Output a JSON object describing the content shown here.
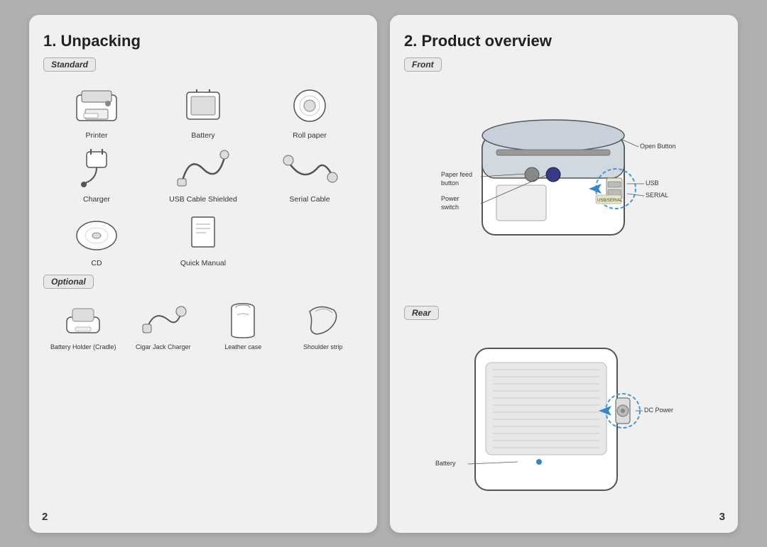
{
  "leftPage": {
    "title": "1. Unpacking",
    "pageNum": "2",
    "standard": {
      "badge": "Standard",
      "items": [
        {
          "label": "Printer",
          "icon": "printer"
        },
        {
          "label": "Battery",
          "icon": "battery"
        },
        {
          "label": "Roll paper",
          "icon": "rollpaper"
        },
        {
          "label": "Charger",
          "icon": "charger"
        },
        {
          "label": "USB Cable Shielded",
          "icon": "usbcable"
        },
        {
          "label": "Serial Cable",
          "icon": "serialcable"
        },
        {
          "label": "CD",
          "icon": "cd"
        },
        {
          "label": "Quick Manual",
          "icon": "manual"
        }
      ]
    },
    "optional": {
      "badge": "Optional",
      "items": [
        {
          "label": "Battery Holder (Cradle)",
          "icon": "cradle"
        },
        {
          "label": "Cigar Jack Charger",
          "icon": "cigarjack"
        },
        {
          "label": "Leather case",
          "icon": "leathercase"
        },
        {
          "label": "Shoulder strip",
          "icon": "shoulderstrip"
        }
      ]
    }
  },
  "rightPage": {
    "title": "2. Product overview",
    "pageNum": "3",
    "front": {
      "badge": "Front",
      "labels": [
        {
          "text": "Open Button",
          "pos": "top-right"
        },
        {
          "text": "Paper feed\nbutton",
          "pos": "left-top"
        },
        {
          "text": "Power\nswitch",
          "pos": "left-mid"
        },
        {
          "text": "USB",
          "pos": "right-mid"
        },
        {
          "text": "SERIAL",
          "pos": "right-low"
        }
      ]
    },
    "rear": {
      "badge": "Rear",
      "labels": [
        {
          "text": "Battery",
          "pos": "left"
        },
        {
          "text": "DC Power",
          "pos": "right"
        }
      ]
    }
  }
}
